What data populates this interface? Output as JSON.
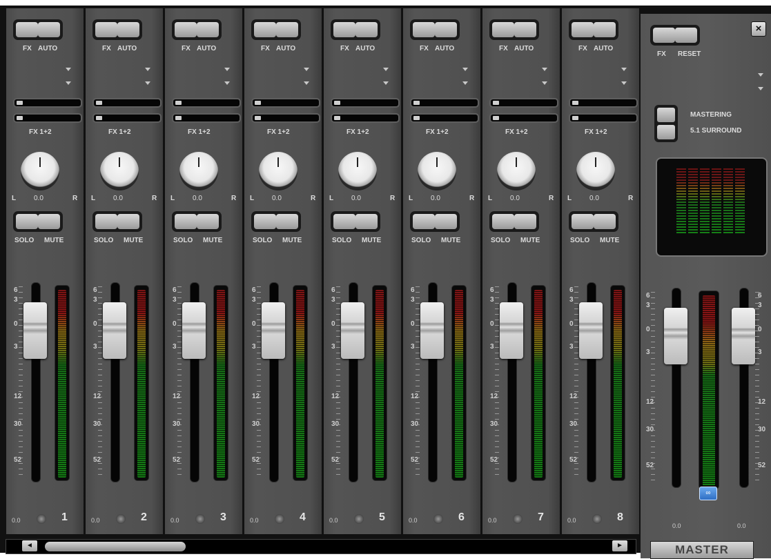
{
  "channels": [
    {
      "fx_label": "FX",
      "auto_label": "AUTO",
      "send_label": "FX 1+2",
      "pan_left": "L",
      "pan_value": "0.0",
      "pan_right": "R",
      "solo_label": "SOLO",
      "mute_label": "MUTE",
      "volume": "0.0",
      "number": "1"
    },
    {
      "fx_label": "FX",
      "auto_label": "AUTO",
      "send_label": "FX 1+2",
      "pan_left": "L",
      "pan_value": "0.0",
      "pan_right": "R",
      "solo_label": "SOLO",
      "mute_label": "MUTE",
      "volume": "0.0",
      "number": "2"
    },
    {
      "fx_label": "FX",
      "auto_label": "AUTO",
      "send_label": "FX 1+2",
      "pan_left": "L",
      "pan_value": "0.0",
      "pan_right": "R",
      "solo_label": "SOLO",
      "mute_label": "MUTE",
      "volume": "0.0",
      "number": "3"
    },
    {
      "fx_label": "FX",
      "auto_label": "AUTO",
      "send_label": "FX 1+2",
      "pan_left": "L",
      "pan_value": "0.0",
      "pan_right": "R",
      "solo_label": "SOLO",
      "mute_label": "MUTE",
      "volume": "0.0",
      "number": "4"
    },
    {
      "fx_label": "FX",
      "auto_label": "AUTO",
      "send_label": "FX 1+2",
      "pan_left": "L",
      "pan_value": "0.0",
      "pan_right": "R",
      "solo_label": "SOLO",
      "mute_label": "MUTE",
      "volume": "0.0",
      "number": "5"
    },
    {
      "fx_label": "FX",
      "auto_label": "AUTO",
      "send_label": "FX 1+2",
      "pan_left": "L",
      "pan_value": "0.0",
      "pan_right": "R",
      "solo_label": "SOLO",
      "mute_label": "MUTE",
      "volume": "0.0",
      "number": "6"
    },
    {
      "fx_label": "FX",
      "auto_label": "AUTO",
      "send_label": "FX 1+2",
      "pan_left": "L",
      "pan_value": "0.0",
      "pan_right": "R",
      "solo_label": "SOLO",
      "mute_label": "MUTE",
      "volume": "0.0",
      "number": "7"
    },
    {
      "fx_label": "FX",
      "auto_label": "AUTO",
      "send_label": "FX 1+2",
      "pan_left": "L",
      "pan_value": "0.0",
      "pan_right": "R",
      "solo_label": "SOLO",
      "mute_label": "MUTE",
      "volume": "0.0",
      "number": "8"
    }
  ],
  "scale_labels": [
    "6",
    "3",
    "0",
    "3",
    "12",
    "30",
    "52"
  ],
  "master": {
    "fx_label": "FX",
    "reset_label": "RESET",
    "close_label": "×",
    "mastering_label": "MASTERING",
    "surround_label": "5.1 SURROUND",
    "link_icon": "link-icon",
    "volume_left": "0.0",
    "volume_right": "0.0",
    "title": "MASTER"
  },
  "scrollbar": {
    "left_arrow": "◄",
    "right_arrow": "►"
  }
}
